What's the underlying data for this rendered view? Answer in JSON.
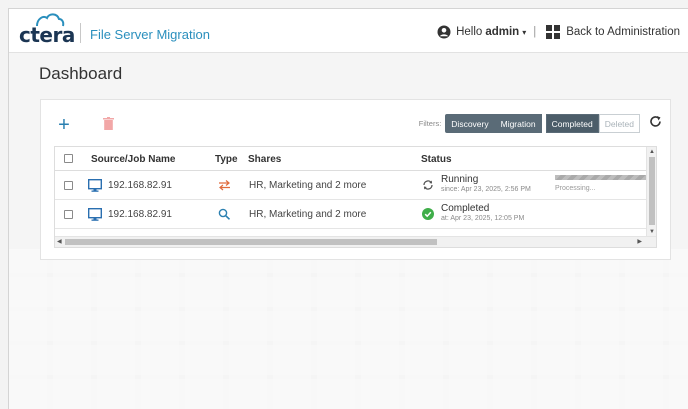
{
  "header": {
    "logo_text": "ctera",
    "app_name": "File Server Migration",
    "hello": "Hello",
    "username": "admin",
    "caret": "▾",
    "separator": "|",
    "back_link": "Back to Administration",
    "brand_color": "#2a8fbd"
  },
  "page": {
    "title": "Dashboard"
  },
  "toolbar": {
    "add_label": "+",
    "add_icon": "plus-icon",
    "delete_icon": "trash-icon"
  },
  "filters": {
    "label": "Filters:",
    "items": [
      {
        "label": "Discovery",
        "state": "on"
      },
      {
        "label": "Migration",
        "state": "on"
      },
      {
        "label": "Completed",
        "state": "on"
      },
      {
        "label": "Deleted",
        "state": "off"
      }
    ],
    "refresh_icon": "refresh-icon"
  },
  "table": {
    "columns": [
      "Source/Job Name",
      "Type",
      "Shares",
      "Status"
    ],
    "rows": [
      {
        "source": "192.168.82.91",
        "type_icon": "migration-arrows-icon",
        "shares": "HR, Marketing and 2 more",
        "status": "Running",
        "status_detail": "since: Apr 23, 2025, 2:56 PM",
        "status_icon": "sync-icon",
        "progress_text": "Processing..."
      },
      {
        "source": "192.168.82.91",
        "type_icon": "discovery-search-icon",
        "shares": "HR, Marketing and 2 more",
        "status": "Completed",
        "status_detail": "at: Apr 23, 2025, 12:05 PM",
        "status_icon": "check-circle-icon",
        "progress_text": ""
      }
    ]
  },
  "colors": {
    "accent": "#2a7fb0",
    "success": "#3fae49",
    "migration": "#e06b3c",
    "filter_active": "#4c5d69"
  }
}
